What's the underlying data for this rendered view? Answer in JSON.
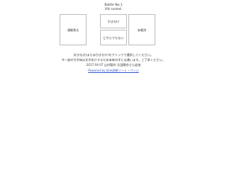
{
  "status": {
    "battle": "Battle No.1",
    "sorted": "0% sorted."
  },
  "options": {
    "left": "浦賀恵太",
    "right": "安間渉",
    "draw": "引き分け",
    "neither": "どちらでもない"
  },
  "notes": {
    "line1": "好きな方(または引き分け)をクリックで選択してください。",
    "line2": "※一部の引字体は文字化けするため本来の字とは違います。ご了承ください。",
    "line3": "2017.04.07 山村製作 天田蔵衣さん追加"
  },
  "footer_link": "Powered by 好み診断ソート・ページ"
}
